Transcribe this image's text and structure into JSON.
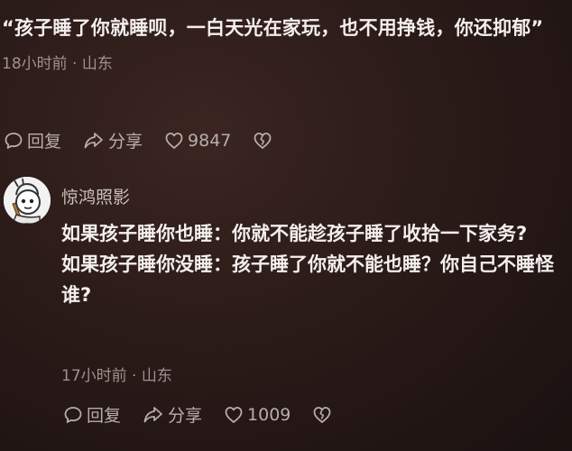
{
  "top_comment": {
    "text": "“孩子睡了你就睡呗，一白天光在家玩，也不用挣钱，你还抑郁”",
    "meta": "18小时前 · 山东",
    "actions": {
      "reply_label": "回复",
      "share_label": "分享",
      "like_count": "9847"
    }
  },
  "reply_comment": {
    "author": "惊鸿照影",
    "lines": [
      "如果孩子睡你也睡：你就不能趁孩子睡了收拾一下家务?",
      "如果孩子睡你没睡：孩子睡了你就不能也睡？你自己不睡怪谁?"
    ],
    "meta": "17小时前 · 山东",
    "actions": {
      "reply_label": "回复",
      "share_label": "分享",
      "like_count": "1009"
    }
  },
  "icons": {
    "reply": "comment-bubble-icon",
    "share": "share-arrow-icon",
    "like": "heart-icon",
    "dislike": "broken-heart-icon"
  },
  "colors": {
    "background": "#2b1b18",
    "text_primary": "#f4efee",
    "text_secondary": "#9d9290",
    "action_color": "#b7adab"
  }
}
